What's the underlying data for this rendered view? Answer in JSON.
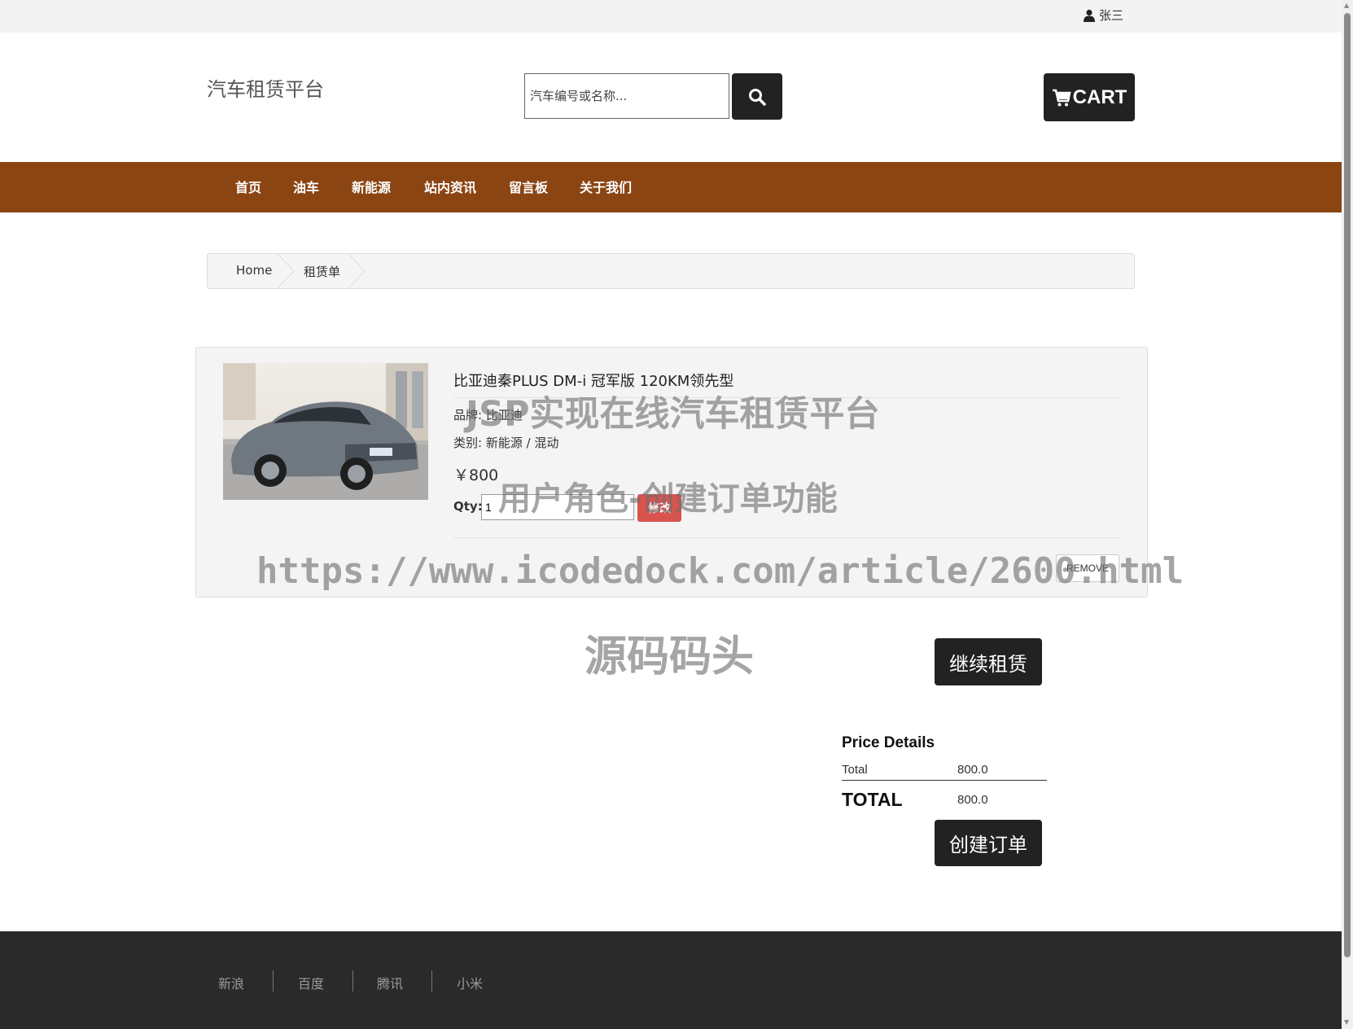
{
  "topbar": {
    "user_name": "张三"
  },
  "header": {
    "brand": "汽车租赁平台",
    "search_placeholder": "汽车编号或名称...",
    "cart_label": "CART"
  },
  "nav": {
    "items": [
      "首页",
      "油车",
      "新能源",
      "站内资讯",
      "留言板",
      "关于我们"
    ]
  },
  "breadcrumb": {
    "home": "Home",
    "current": "租赁单"
  },
  "cart_item": {
    "title": "比亚迪秦PLUS DM-i 冠军版 120KM领先型",
    "brand": "品牌: 比亚迪",
    "category": "类别:  新能源 / 混动",
    "price": "￥800",
    "qty_label": "Qty:",
    "qty_value": "1",
    "edit_label": "修改",
    "remove_label": "REMOVE"
  },
  "actions": {
    "continue_label": "继续租赁",
    "create_label": "创建订单"
  },
  "price_details": {
    "title": "Price Details",
    "total_label": "Total",
    "total_value": "800.0",
    "grand_label": "TOTAL",
    "grand_value": "800.0"
  },
  "footer": {
    "links": [
      "新浪",
      "百度",
      "腾讯",
      "小米"
    ]
  },
  "watermark": {
    "line1": "JSP实现在线汽车租赁平台",
    "line2": "用户角色-创建订单功能",
    "line3": "https://www.icodedock.com/article/2600.html",
    "line4": "源码码头"
  },
  "colors": {
    "nav_bg": "#8b4513",
    "dark_button": "#222222",
    "edit_button": "#d9534f",
    "footer_bg": "#2a2a2a"
  }
}
